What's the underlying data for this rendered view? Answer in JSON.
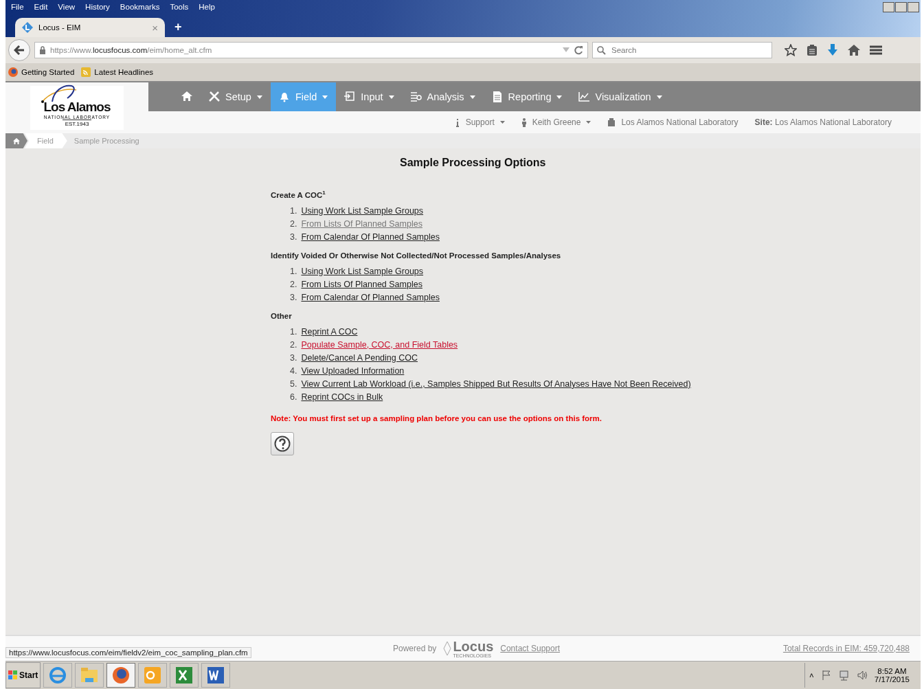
{
  "menu_bar": [
    "File",
    "Edit",
    "View",
    "History",
    "Bookmarks",
    "Tools",
    "Help"
  ],
  "tab": {
    "title": "Locus - EIM",
    "close": "×",
    "new_tab": "+"
  },
  "address_bar": {
    "host_prefix": "https://www.",
    "host": "locusfocus.com",
    "path": "/eim/home_alt.cfm"
  },
  "search": {
    "placeholder": "Search"
  },
  "bookmarks": [
    {
      "label": "Getting Started",
      "kind": "firefox"
    },
    {
      "label": "Latest Headlines",
      "kind": "rss"
    }
  ],
  "logo": {
    "name": "Los Alamos",
    "subtitle": "NATIONAL LABORATORY",
    "est": "EST.1943"
  },
  "nav": [
    {
      "kind": "home",
      "selected": false
    },
    {
      "label": "Setup",
      "kind": "tools",
      "selected": false
    },
    {
      "label": "Field",
      "kind": "bell",
      "selected": true
    },
    {
      "label": "Input",
      "kind": "input",
      "selected": false
    },
    {
      "label": "Analysis",
      "kind": "analysis",
      "selected": false
    },
    {
      "label": "Reporting",
      "kind": "doc",
      "selected": false
    },
    {
      "label": "Visualization",
      "kind": "chart",
      "selected": false
    }
  ],
  "sub_bar": [
    {
      "label": "Support",
      "kind": "info",
      "dropdown": true
    },
    {
      "label": "Keith Greene",
      "kind": "user",
      "dropdown": true
    },
    {
      "label": "Los Alamos National Laboratory",
      "kind": "building",
      "dropdown": false
    }
  ],
  "site": {
    "label": "Site:",
    "value": "Los Alamos National Laboratory"
  },
  "breadcrumb": [
    "Field",
    "Sample Processing"
  ],
  "title": "Sample Processing Options",
  "sections": [
    {
      "heading": "Create A COC$^{1}$",
      "items": [
        {
          "n": "1.",
          "text": "Using Work List Sample Groups",
          "visited": false,
          "hovered": false
        },
        {
          "n": "2.",
          "text": "From Lists Of Planned Samples",
          "visited": true,
          "hovered": false
        },
        {
          "n": "3.",
          "text": "From Calendar Of Planned Samples",
          "visited": false,
          "hovered": false
        }
      ]
    },
    {
      "heading": "Identify Voided Or Otherwise Not Collected/Not Processed Samples/Analyses",
      "items": [
        {
          "n": "1.",
          "text": "Using Work List Sample Groups",
          "visited": false,
          "hovered": false
        },
        {
          "n": "2.",
          "text": "From Lists Of Planned Samples",
          "visited": false,
          "hovered": false
        },
        {
          "n": "3.",
          "text": "From Calendar Of Planned Samples",
          "visited": false,
          "hovered": false
        }
      ]
    },
    {
      "heading": "Other",
      "items": [
        {
          "n": "1.",
          "text": "Reprint A COC",
          "visited": false,
          "hovered": false
        },
        {
          "n": "2.",
          "text": "Populate Sample, COC, and Field Tables",
          "visited": false,
          "hovered": true
        },
        {
          "n": "3.",
          "text": "Delete/Cancel A Pending COC",
          "visited": false,
          "hovered": false
        },
        {
          "n": "4.",
          "text": "View Uploaded Information",
          "visited": false,
          "hovered": false
        },
        {
          "n": "5.",
          "text": "View Current Lab Workload (i.e., Samples Shipped But Results Of Analyses Have Not Been Received)",
          "visited": false,
          "hovered": false
        },
        {
          "n": "6.",
          "text": "Reprint COCs in Bulk",
          "visited": false,
          "hovered": false
        }
      ]
    }
  ],
  "note": "Note: You must first set up a sampling plan before you can use the options on this form.",
  "footer": {
    "status_url": "https://www.locusfocus.com/eim/fieldv2/eim_coc_sampling_plan.cfm",
    "powered_by": "Powered by",
    "brand": "Locus",
    "brand_sub": "TECHNOLOGIES",
    "contact": "Contact Support",
    "total": "Total Records in EIM:  459,720,488"
  },
  "taskbar": {
    "start": "Start",
    "apps": [
      {
        "kind": "ie",
        "selected": false
      },
      {
        "kind": "explorer",
        "selected": false
      },
      {
        "kind": "firefox",
        "selected": true
      },
      {
        "kind": "outlook",
        "selected": false
      },
      {
        "kind": "excel",
        "selected": false
      },
      {
        "kind": "word",
        "selected": false
      }
    ],
    "tray_toggle": "˄",
    "time": "8:52 AM",
    "date": "7/17/2015"
  }
}
